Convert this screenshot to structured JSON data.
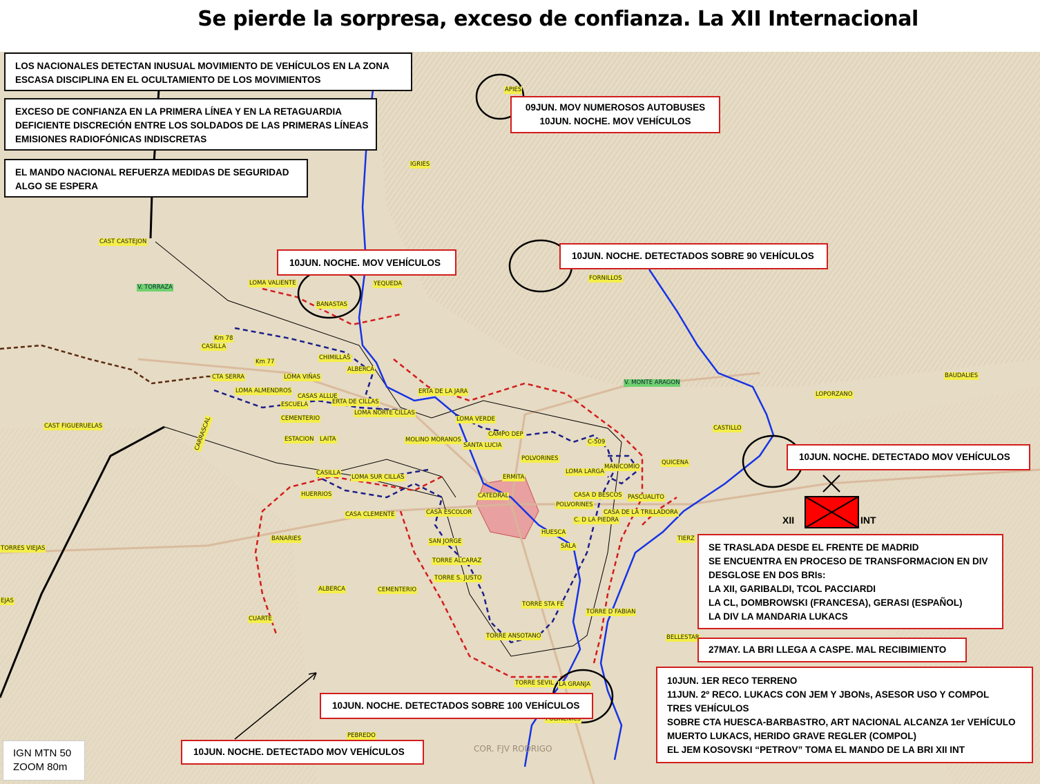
{
  "title": "Se pierde la sorpresa, exceso de confianza. La XII Internacional",
  "colors": {
    "river": "#1533e6",
    "nationalist_front": "#d21c1c",
    "republican_front": "#1b1f8a",
    "unit_fill": "#ff0000",
    "map_bg": "#e6dbc4"
  },
  "intel_boxes": [
    {
      "lines": [
        "LOS NACIONALES DETECTAN INUSUAL MOVIMIENTO DE VEHÍCULOS EN LA ZONA",
        "ESCASA DISCIPLINA EN EL OCULTAMIENTO DE LOS MOVIMIENTOS"
      ]
    },
    {
      "lines": [
        "EXCESO DE CONFIANZA EN LA PRIMERA LÍNEA Y EN LA RETAGUARDIA",
        "DEFICIENTE DISCRECIÓN ENTRE LOS SOLDADOS DE LAS PRIMERAS LÍNEAS",
        "EMISIONES RADIOFÓNICAS INDISCRETAS"
      ]
    },
    {
      "lines": [
        "EL MANDO NACIONAL REFUERZA MEDIDAS DE SEGURIDAD",
        "ALGO SE ESPERA"
      ]
    }
  ],
  "event_boxes": {
    "apies": [
      "09JUN. MOV NUMEROSOS AUTOBUSES",
      "10JUN. NOCHE. MOV VEHÍCULOS"
    ],
    "banastas": [
      "10JUN. NOCHE. MOV VEHÍCULOS"
    ],
    "fornillos": [
      "10JUN. NOCHE. DETECTADOS SOBRE 90 VEHÍCULOS"
    ],
    "castillo": [
      "10JUN. NOCHE. DETECTADO MOV  VEHÍCULOS"
    ],
    "granja": [
      "10JUN. NOCHE. DETECTADOS SOBRE 100 VEHÍCULOS"
    ],
    "south": [
      "10JUN. NOCHE. DETECTADO MOV  VEHÍCULOS"
    ]
  },
  "brigade_info": [
    "SE TRASLADA DESDE EL FRENTE DE MADRID",
    "SE ENCUENTRA EN PROCESO DE TRANSFORMACION EN DIV",
    "DESGLOSE EN DOS BRIs:",
    "LA XII, GARIBALDI, TCOL PACCIARDI",
    "LA CL, DOMBROWSKI (FRANCESA), GERASI (ESPAÑOL)",
    "LA DIV LA MANDARIA LUKACS"
  ],
  "caspe_box": [
    "27MAY. LA BRI LLEGA A CASPE. MAL RECIBIMIENTO"
  ],
  "reco_box": [
    "10JUN. 1ER RECO TERRENO",
    "11JUN.  2º RECO. LUKACS CON JEM Y JBONs, ASESOR USO Y COMPOL",
    "TRES VEHÍCULOS",
    "SOBRE CTA HUESCA-BARBASTRO, ART NACIONAL ALCANZA 1er VEHÍCULO",
    "MUERTO LUKACS, HERIDO GRAVE REGLER (COMPOL)",
    "EL JEM KOSOVSKI “PETROV” TOMA EL MANDO DE LA BRI XII INT"
  ],
  "unit_symbol": {
    "left_label": "XII",
    "right_label": "INT"
  },
  "map_source": [
    "IGN MTN 50",
    "ZOOM 80m"
  ],
  "watermark": "COR. FJV RODRIGO",
  "place_labels": [
    "APIES",
    "IGRIES",
    "CAST CASTEJON",
    "V. TORRAZA",
    "LOMA VALIENTE",
    "BANASTAS",
    "YEQUEDA",
    "FORNILLOS",
    "Km 78",
    "CASILLA",
    "Km 77",
    "CHIMILLAS",
    "ALBERCA",
    "CTA SERRA",
    "LOMA VIÑAS",
    "LOMA ALMENDROS",
    "CASAS ALLUE",
    "ERTA DE CILLAS",
    "ESCUELA",
    "LOMA NORTE CILLAS",
    "ERTA DE LA JARA",
    "CEMENTERIO",
    "CAST FIGUERUELAS",
    "CARRASCAL",
    "ESTACION",
    "LAITA",
    "LOMA VERDE",
    "CAMPO DEP",
    "MOLINO MORANOS",
    "SANTA LUCIA",
    "C-509",
    "POLVORINES",
    "LOMA LARGA",
    "MANICOMIO",
    "ERMITA",
    "QUICENA",
    "CASTILLO",
    "V. MONTE ARAGON",
    "LOPORZANO",
    "BAUDALIES",
    "CASILLA",
    "LOMA SUR CILLAS",
    "HUERRIOS",
    "CATEDRAL",
    "CASA D BESCOS",
    "PASCUALITO",
    "POLVORINES",
    "CASA DE LA TRILLADORA",
    "C. D LA PIEDRA",
    "CASA CLEMENTE",
    "CASA ESCOLOR",
    "BANARIES",
    "SAN JORGE",
    "HUESCA",
    "SALA",
    "TORRE ALCARAZ",
    "TORRE S. JUSTO",
    "ALBERCA",
    "CEMENTERIO",
    "TORRE STA FE",
    "TORRE D FABIAN",
    "CUARTE",
    "TORRE ANSOTANO",
    "BELLESTAR",
    "TORRE SEVIL",
    "LA GRANJA",
    "POLIÑENICS",
    "TIERZ",
    "TORRES VIEJAS",
    "EJAS",
    "PEBREDO"
  ]
}
